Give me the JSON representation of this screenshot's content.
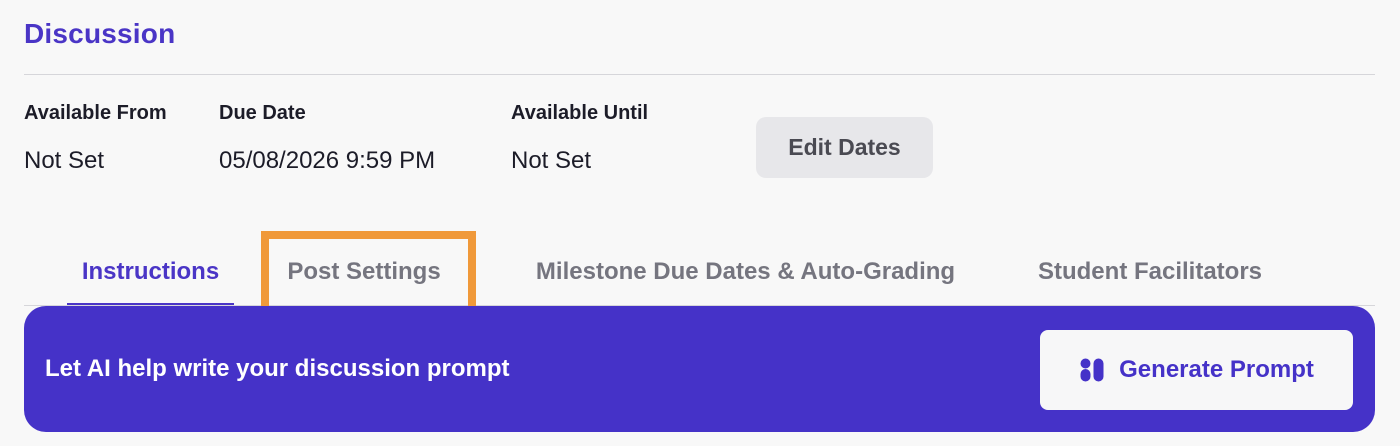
{
  "header": {
    "title": "Discussion"
  },
  "dates": {
    "available_from": {
      "label": "Available From",
      "value": "Not Set"
    },
    "due_date": {
      "label": "Due Date",
      "value": "05/08/2026 9:59 PM"
    },
    "available_until": {
      "label": "Available Until",
      "value": "Not Set"
    },
    "edit_label": "Edit Dates"
  },
  "tabs": [
    {
      "label": "Instructions",
      "active": true
    },
    {
      "label": "Post Settings",
      "active": false,
      "highlighted": true
    },
    {
      "label": "Milestone Due Dates & Auto-Grading",
      "active": false
    },
    {
      "label": "Student Facilitators",
      "active": false
    }
  ],
  "ai_banner": {
    "text": "Let AI help write your discussion prompt",
    "button_label": "Generate Prompt",
    "button_icon": "ai-sparkle-icon"
  },
  "colors": {
    "accent": "#4a35c6",
    "banner": "#4532c8",
    "highlight": "#f0993a",
    "page_bg": "#f8f8f8"
  }
}
